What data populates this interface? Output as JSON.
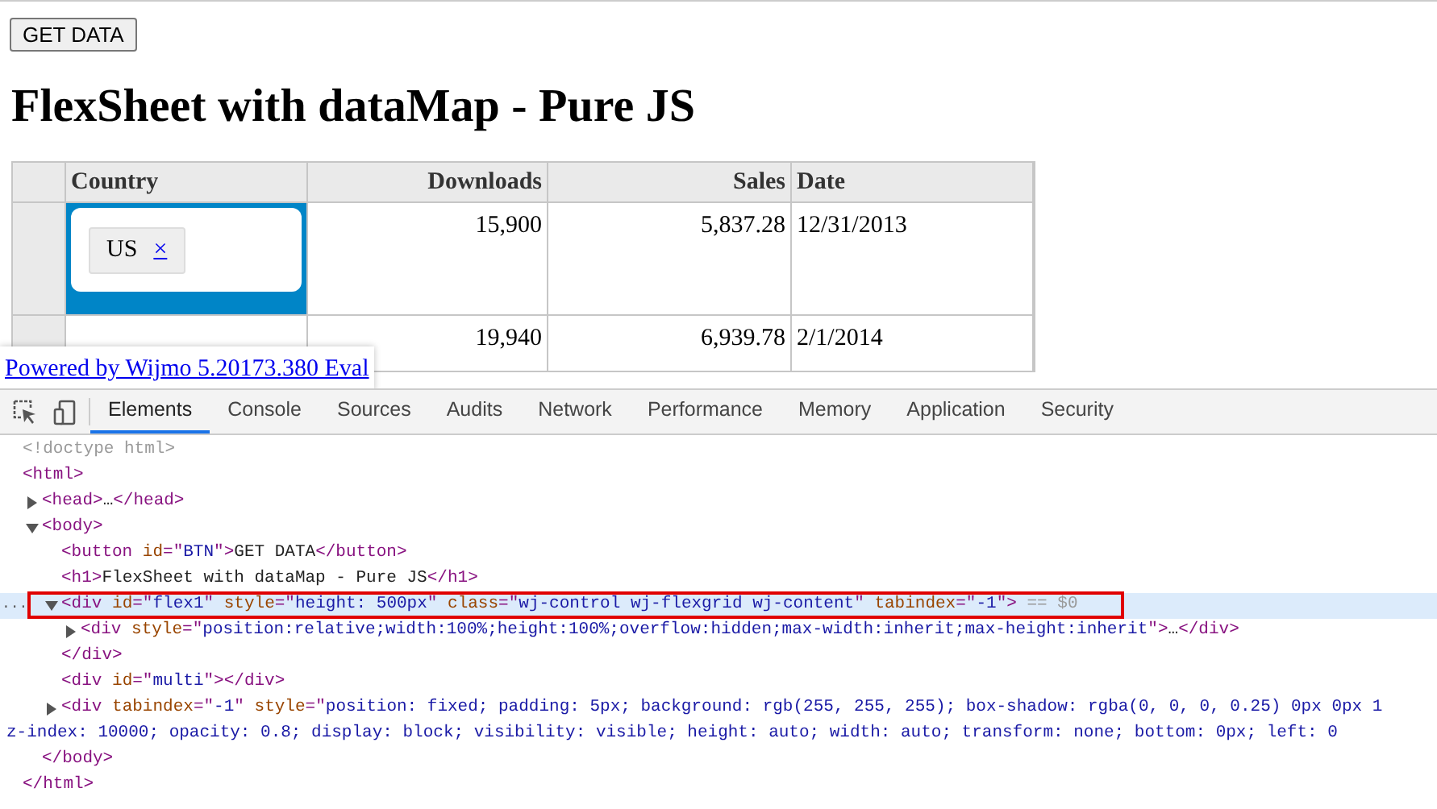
{
  "page": {
    "button": "GET DATA",
    "heading": "FlexSheet with dataMap - Pure JS",
    "grid": {
      "columns": [
        {
          "label": "Country",
          "kind": "text"
        },
        {
          "label": "Downloads",
          "kind": "number"
        },
        {
          "label": "Sales",
          "kind": "number"
        },
        {
          "label": "Date",
          "kind": "text"
        }
      ],
      "rows": [
        {
          "editing": true,
          "cells": [
            {
              "kind": "tags",
              "tags": [
                "US"
              ]
            },
            {
              "kind": "value",
              "text": "15,900"
            },
            {
              "kind": "value",
              "text": "5,837.28"
            },
            {
              "kind": "value",
              "text": "12/31/2013"
            }
          ]
        },
        {
          "editing": false,
          "cells": [
            {
              "kind": "tags"
            },
            {
              "kind": "value",
              "text": "19,940"
            },
            {
              "kind": "value",
              "text": "6,939.78"
            },
            {
              "kind": "value",
              "text": "2/1/2014"
            }
          ]
        }
      ],
      "tag_remove": "×"
    },
    "watermark_link": "Powered by Wijmo 5.20173.380 Eval"
  },
  "devtools": {
    "tabs": [
      {
        "label": "Elements",
        "selected": true
      },
      {
        "label": "Console",
        "selected": false
      },
      {
        "label": "Sources",
        "selected": false
      },
      {
        "label": "Audits",
        "selected": false
      },
      {
        "label": "Network",
        "selected": false
      },
      {
        "label": "Performance",
        "selected": false
      },
      {
        "label": "Memory",
        "selected": false
      },
      {
        "label": "Application",
        "selected": false
      },
      {
        "label": "Security",
        "selected": false
      }
    ],
    "selected_marker": "...",
    "tree": [
      {
        "line": [
          {
            "kind": "doctype",
            "text": "<!doctype html>"
          }
        ]
      },
      {
        "line": [
          {
            "kind": "tag",
            "text": "<html>"
          }
        ],
        "closing": [
          {
            "kind": "tag",
            "text": "</html>"
          }
        ],
        "children": [
          {
            "expanded": false,
            "line": [
              {
                "kind": "tag",
                "text": "<head>"
              },
              {
                "kind": "text",
                "text": "…"
              },
              {
                "kind": "tag",
                "text": "</head>"
              }
            ]
          },
          {
            "expanded": true,
            "line": [
              {
                "kind": "tag",
                "text": "<body>"
              }
            ],
            "closing": [
              {
                "kind": "tag",
                "text": "</body>"
              }
            ],
            "children": [
              {
                "line": [
                  {
                    "kind": "tag",
                    "text": "<button"
                  },
                  {
                    "kind": "attr",
                    "text": " id"
                  },
                  {
                    "kind": "tag",
                    "text": "=\""
                  },
                  {
                    "kind": "value",
                    "text": "BTN"
                  },
                  {
                    "kind": "tag",
                    "text": "\">"
                  },
                  {
                    "kind": "text",
                    "text": "GET DATA"
                  },
                  {
                    "kind": "tag",
                    "text": "</button>"
                  }
                ]
              },
              {
                "line": [
                  {
                    "kind": "tag",
                    "text": "<h1>"
                  },
                  {
                    "kind": "text",
                    "text": "FlexSheet with dataMap - Pure JS"
                  },
                  {
                    "kind": "tag",
                    "text": "</h1>"
                  }
                ]
              },
              {
                "expanded": true,
                "selected": true,
                "line": [
                  {
                    "kind": "tag",
                    "text": "<div"
                  },
                  {
                    "kind": "attr",
                    "text": " id"
                  },
                  {
                    "kind": "tag",
                    "text": "=\""
                  },
                  {
                    "kind": "value",
                    "text": "flex1"
                  },
                  {
                    "kind": "tag",
                    "text": "\""
                  },
                  {
                    "kind": "attr",
                    "text": " style"
                  },
                  {
                    "kind": "tag",
                    "text": "=\""
                  },
                  {
                    "kind": "value",
                    "text": "height: 500px"
                  },
                  {
                    "kind": "tag",
                    "text": "\""
                  },
                  {
                    "kind": "attr",
                    "text": " class"
                  },
                  {
                    "kind": "tag",
                    "text": "=\""
                  },
                  {
                    "kind": "value",
                    "text": "wj-control wj-flexgrid wj-content"
                  },
                  {
                    "kind": "tag",
                    "text": "\""
                  },
                  {
                    "kind": "attr",
                    "text": " tabindex"
                  },
                  {
                    "kind": "tag",
                    "text": "=\""
                  },
                  {
                    "kind": "value",
                    "text": "-1"
                  },
                  {
                    "kind": "tag",
                    "text": "\">"
                  },
                  {
                    "kind": "doctype",
                    "text": " == $0"
                  }
                ],
                "closing": [
                  {
                    "kind": "tag",
                    "text": "</div>"
                  }
                ],
                "children": [
                  {
                    "expanded": false,
                    "line": [
                      {
                        "kind": "tag",
                        "text": "<div"
                      },
                      {
                        "kind": "attr",
                        "text": " style"
                      },
                      {
                        "kind": "tag",
                        "text": "=\""
                      },
                      {
                        "kind": "value",
                        "text": "position:relative;width:100%;height:100%;overflow:hidden;max-width:inherit;max-height:inherit"
                      },
                      {
                        "kind": "tag",
                        "text": "\">"
                      },
                      {
                        "kind": "text",
                        "text": "…"
                      },
                      {
                        "kind": "tag",
                        "text": "</div>"
                      }
                    ]
                  }
                ]
              },
              {
                "line": [
                  {
                    "kind": "tag",
                    "text": "<div"
                  },
                  {
                    "kind": "attr",
                    "text": " id"
                  },
                  {
                    "kind": "tag",
                    "text": "=\""
                  },
                  {
                    "kind": "value",
                    "text": "multi"
                  },
                  {
                    "kind": "tag",
                    "text": "\"></div>"
                  }
                ]
              },
              {
                "expanded": false,
                "line": [
                  {
                    "kind": "tag",
                    "text": "<div"
                  },
                  {
                    "kind": "attr",
                    "text": " tabindex"
                  },
                  {
                    "kind": "tag",
                    "text": "=\""
                  },
                  {
                    "kind": "value",
                    "text": "-1"
                  },
                  {
                    "kind": "tag",
                    "text": "\""
                  },
                  {
                    "kind": "attr",
                    "text": " style"
                  },
                  {
                    "kind": "tag",
                    "text": "=\""
                  },
                  {
                    "kind": "value",
                    "text": "position: fixed; padding: 5px; background: rgb(255, 255, 255); box-shadow: rgba(0, 0, 0, 0.25) 0px 0px 1"
                  }
                ],
                "continuation": [
                  {
                    "kind": "value",
                    "text": "z-index: 10000; opacity: 0.8; display: block; visibility: visible; height: auto; width: auto; transform: none; bottom: 0px; left: 0"
                  }
                ]
              }
            ]
          }
        ]
      }
    ]
  }
}
